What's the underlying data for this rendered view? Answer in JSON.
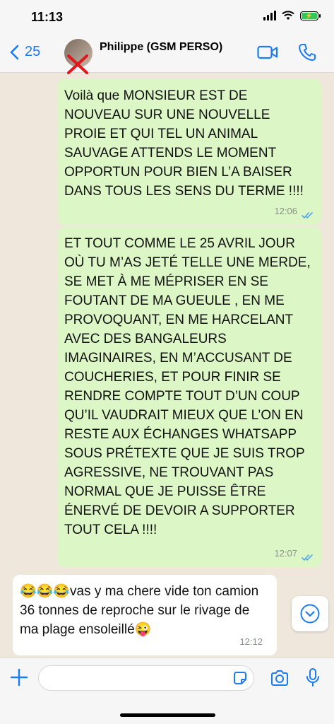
{
  "status": {
    "time": "11:13",
    "battery_label": "⚡"
  },
  "header": {
    "back_count": "25",
    "contact_name": "Philippe (GSM PERSO)"
  },
  "messages": [
    {
      "direction": "out",
      "text": "Voilà que MONSIEUR EST DE NOUVEAU SUR UNE NOUVELLE PROIE ET QUI TEL UN ANIMAL SAUVAGE ATTENDS LE MOMENT OPPORTUN POUR BIEN L’A BAISER DANS TOUS LES SENS DU TERME !!!!",
      "time": "12:06",
      "read": true
    },
    {
      "direction": "out",
      "text": "ET TOUT COMME LE 25 AVRIL JOUR OÙ TU M’AS JETÉ TELLE UNE MERDE, SE MET À ME MÉPRISER EN SE FOUTANT DE MA GUEULE , EN ME PROVOQUANT, EN ME HARCELANT AVEC DES BANGALEURS IMAGINAIRES, EN M’ACCUSANT DE COUCHERIES, ET POUR FINIR SE RENDRE COMPTE TOUT D’UN COUP QU’IL VAUDRAIT MIEUX QUE L’ON EN RESTE AUX ÉCHANGES WHATSAPP SOUS PRÉTEXTE QUE JE SUIS TROP AGRESSIVE, NE TROUVANT PAS NORMAL QUE JE PUISSE ÊTRE ÉNERVÉ DE DEVOIR A SUPPORTER TOUT CELA !!!!",
      "time": "12:07",
      "read": true
    },
    {
      "direction": "in",
      "text": "😂😂😂vas y ma chere vide ton camion 36 tonnes de reproche sur le rivage de ma plage ensoleillé😜",
      "time": "12:12"
    }
  ],
  "input": {
    "placeholder": ""
  },
  "colors": {
    "accent": "#1a7cf5",
    "bubble_out": "#dcf7c5",
    "read_ticks": "#4fa6f0"
  },
  "icons": [
    "back-chevron-icon",
    "video-call-icon",
    "phone-call-icon",
    "chevron-down-icon",
    "plus-icon",
    "sticker-icon",
    "camera-icon",
    "mic-icon",
    "read-ticks-icon"
  ]
}
